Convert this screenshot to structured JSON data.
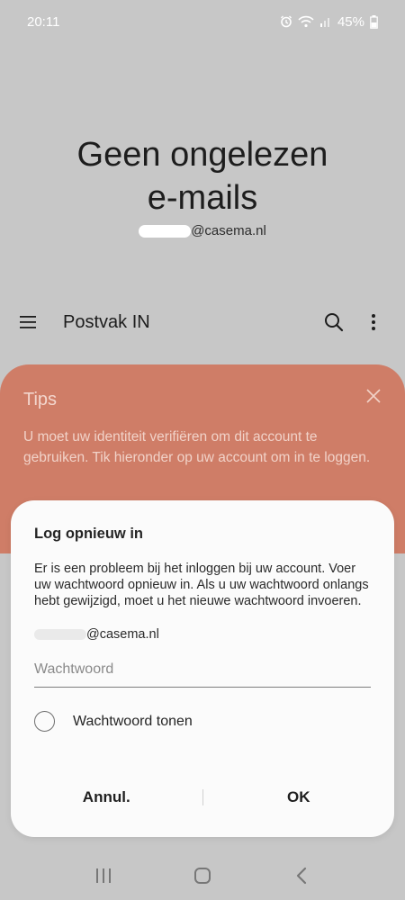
{
  "status_bar": {
    "time": "20:11",
    "battery": "45%",
    "icons": [
      "alarm-icon",
      "wifi-icon",
      "signal-icon",
      "battery-icon"
    ]
  },
  "header": {
    "title_line1": "Geen ongelezen",
    "title_line2": "e-mails",
    "account_suffix": "@casema.nl"
  },
  "toolbar": {
    "title": "Postvak IN",
    "icons": [
      "menu-icon",
      "search-icon",
      "more-options-icon"
    ]
  },
  "tips": {
    "title": "Tips",
    "text": "U moet uw identiteit verifiëren om dit account te gebruiken. Tik hieronder op uw account om in te loggen.",
    "color": "#cf7d67"
  },
  "dialog": {
    "title": "Log opnieuw in",
    "message": "Er is een probleem bij het inloggen bij uw account. Voer uw wachtwoord opnieuw in. Als u uw wachtwoord onlangs hebt gewijzigd, moet u het nieuwe wachtwoord invoeren.",
    "account_suffix": "@casema.nl",
    "password_placeholder": "Wachtwoord",
    "password_value": "",
    "show_password_label": "Wachtwoord tonen",
    "show_password_checked": false,
    "cancel_label": "Annul.",
    "ok_label": "OK"
  },
  "nav_bar": {
    "icons": [
      "recent-apps-icon",
      "home-icon",
      "back-icon"
    ]
  }
}
